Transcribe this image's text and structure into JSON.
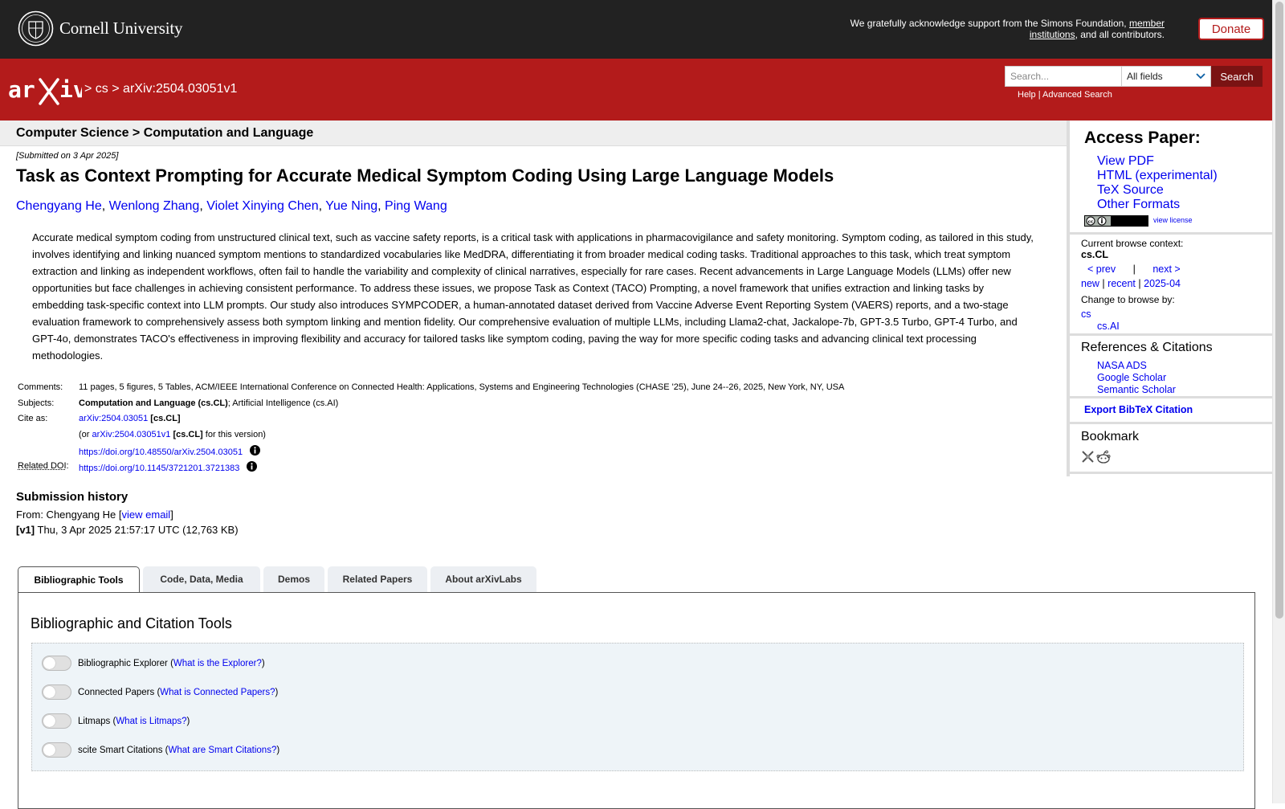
{
  "banner": {
    "university": "Cornell University",
    "support_prefix": "We gratefully acknowledge support from the Simons Foundation,",
    "support_link": "member institutions",
    "support_suffix": ", and all contributors.",
    "donate": "Donate"
  },
  "header": {
    "crumb_sep": ">",
    "crumb_cs": "cs",
    "crumb_id": "arXiv:2504.03051v1",
    "search_placeholder": "Search...",
    "field_select": "All fields",
    "search_button": "Search",
    "help": "Help",
    "help_sep": "|",
    "advanced": "Advanced Search"
  },
  "paper": {
    "subject_path": "Computer Science > Computation and Language",
    "submitted": "[Submitted on 3 Apr 2025]",
    "title": "Task as Context Prompting for Accurate Medical Symptom Coding Using Large Language Models",
    "authors": [
      "Chengyang He",
      "Wenlong Zhang",
      "Violet Xinying Chen",
      "Yue Ning",
      "Ping Wang"
    ],
    "author_sep": ",",
    "abstract": "Accurate medical symptom coding from unstructured clinical text, such as vaccine safety reports, is a critical task with applications in pharmacovigilance and safety monitoring. Symptom coding, as tailored in this study, involves identifying and linking nuanced symptom mentions to standardized vocabularies like MedDRA, differentiating it from broader medical coding tasks. Traditional approaches to this task, which treat symptom extraction and linking as independent workflows, often fail to handle the variability and complexity of clinical narratives, especially for rare cases. Recent advancements in Large Language Models (LLMs) offer new opportunities but face challenges in achieving consistent performance. To address these issues, we propose Task as Context (TACO) Prompting, a novel framework that unifies extraction and linking tasks by embedding task-specific context into LLM prompts. Our study also introduces SYMPCODER, a human-annotated dataset derived from Vaccine Adverse Event Reporting System (VAERS) reports, and a two-stage evaluation framework to comprehensively assess both symptom linking and mention fidelity. Our comprehensive evaluation of multiple LLMs, including Llama2-chat, Jackalope-7b, GPT-3.5 Turbo, GPT-4 Turbo, and GPT-4o, demonstrates TACO's effectiveness in improving flexibility and accuracy for tailored tasks like symptom coding, paving the way for more specific coding tasks and advancing clinical text processing methodologies."
  },
  "meta": {
    "comments_label": "Comments:",
    "comments": "11 pages, 5 figures, 5 Tables, ACM/IEEE International Conference on Connected Health: Applications, Systems and Engineering Technologies (CHASE '25), June 24--26, 2025, New York, NY, USA",
    "subjects_label": "Subjects:",
    "subjects_primary": "Computation and Language (cs.CL)",
    "subjects_rest": "; Artificial Intelligence (cs.AI)",
    "cite_label": "Cite as:",
    "cite_id": "arXiv:2504.03051",
    "cite_cat": "[cs.CL]",
    "cite_or_prefix": "(or",
    "cite_version": "arXiv:2504.03051v1",
    "cite_or_suffix": "for this version)",
    "cite_doi": "https://doi.org/10.48550/arXiv.2504.03051",
    "related_doi_abbr": "Related DOI",
    "related_doi_colon": ":",
    "related_doi": "https://doi.org/10.1145/3721201.3721383"
  },
  "history": {
    "title": "Submission history",
    "from_prefix": "From: Chengyang He [",
    "view_email": "view email",
    "from_suffix": "]",
    "v1_label": "[v1]",
    "v1_text": "Thu, 3 Apr 2025 21:57:17 UTC (12,763 KB)"
  },
  "tabs": [
    {
      "label": "Bibliographic Tools"
    },
    {
      "label": "Code, Data, Media"
    },
    {
      "label": "Demos"
    },
    {
      "label": "Related Papers"
    },
    {
      "label": "About arXivLabs"
    }
  ],
  "panel": {
    "title": "Bibliographic and Citation Tools",
    "tools": [
      {
        "name": "Bibliographic Explorer",
        "link": "What is the Explorer?"
      },
      {
        "name": "Connected Papers",
        "link": "What is Connected Papers?"
      },
      {
        "name": "Litmaps",
        "link": "What is Litmaps?"
      },
      {
        "name": "scite Smart Citations",
        "link": "What are Smart Citations?"
      }
    ]
  },
  "sidebar": {
    "access_title": "Access Paper:",
    "access_links": [
      "View PDF",
      "HTML (experimental)",
      "TeX Source",
      "Other Formats"
    ],
    "view_license": "view license",
    "context_label": "Current browse context:",
    "context_value": "cs.CL",
    "prev": "< prev",
    "nav_sep": "|",
    "next": "next >",
    "new": "new",
    "recent": "recent",
    "month": "2025-04",
    "change_label": "Change to browse by:",
    "browse_cs": "cs",
    "browse_csai": "cs.AI",
    "refs_title": "References & Citations",
    "refs": [
      "NASA ADS",
      "Google Scholar",
      "Semantic Scholar"
    ],
    "export": "Export BibTeX Citation",
    "bookmark_title": "Bookmark"
  },
  "colors": {
    "arxiv_red": "#b31b1b",
    "banner_dark": "#222222",
    "link_blue": "#0000ee"
  }
}
